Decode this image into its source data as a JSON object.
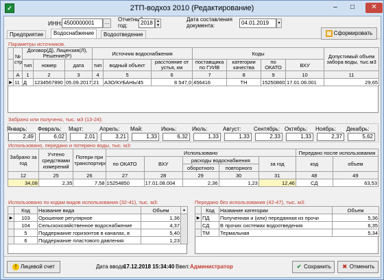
{
  "window": {
    "title": "2ТП-водхоз 2010 (Редактирование)",
    "minimize": "–",
    "maximize": "□",
    "close": "✕"
  },
  "header": {
    "inn_label": "ИНН:",
    "inn_value": "4500000001",
    "inn_btn": "...",
    "year_label": "Отчетный год:",
    "year_value": "2018",
    "date_label": "Дата составления документа:",
    "date_value": "04.01.2019",
    "form_button": "Сформировать"
  },
  "tabs": [
    {
      "label": "Предприятие"
    },
    {
      "label": "Водоснабжение"
    },
    {
      "label": "Водоотведение"
    }
  ],
  "sources": {
    "section": "Параметры источников.",
    "h_num": "№ стр",
    "h_contract": "Договор(Д), Лицензия(Л), Решение(Р)",
    "h_source": "Источник водоснабжения",
    "h_codes": "Коды",
    "h_limit": "Допустимый объем забора воды, тыс.м3",
    "h_type": "тип",
    "h_number": "номер",
    "h_date": "дата",
    "h_stype": "тип",
    "h_object": "водный объект",
    "h_distance": "расстояние от устья, км",
    "h_gouv": "поставщика по ГУИВ",
    "h_quality": "категории качества",
    "h_okato": "по ОКАТО",
    "h_vhu": "ВХУ",
    "n": [
      "А",
      "1",
      "2",
      "3",
      "4",
      "5",
      "6",
      "7",
      "8",
      "9",
      "10",
      "11"
    ],
    "row": {
      "num": "11",
      "type": "Д",
      "number": "1234567890",
      "date": "05.09.2017",
      "stype": "21",
      "object": "АЗО/КУБАНЬ/45",
      "distance": "8 547,0",
      "gouv": "456416",
      "quality": "ТН",
      "okato": "15250860",
      "vhu": "17.01.06.001",
      "limit": "29,65"
    }
  },
  "received": {
    "section": "Забрано или получено, тыс. м3 (13-24):",
    "months": [
      {
        "label": "Январь:",
        "value": "2,49"
      },
      {
        "label": "Февраль:",
        "value": "6,02"
      },
      {
        "label": "Март:",
        "value": "2,01"
      },
      {
        "label": "Апрель:",
        "value": "3,21"
      },
      {
        "label": "Май:",
        "value": "1,33"
      },
      {
        "label": "Июнь:",
        "value": "6,32"
      },
      {
        "label": "Июль:",
        "value": "1,33"
      },
      {
        "label": "Август:",
        "value": "1,33"
      },
      {
        "label": "Сентябрь:",
        "value": "2,33"
      },
      {
        "label": "Октябрь:",
        "value": "1,33"
      },
      {
        "label": "Ноябрь:",
        "value": "2,37"
      },
      {
        "label": "Декабрь:",
        "value": "5,62"
      }
    ]
  },
  "used": {
    "section": "Использовано, передано и потеряно воды, тыс. м3:",
    "h_taken": "Забрано за год",
    "h_meas": "Учтено средствами измерений",
    "h_loss": "Потери при транспортировке",
    "h_used": "Использовано",
    "h_okato": "по ОКАТО",
    "h_vhu": "ВХУ",
    "h_consumption": "расходы водоснабжения",
    "h_circ": "оборотного",
    "h_repeat": "повторного",
    "h_year": "за год",
    "h_passed": "Передано после использования",
    "h_code": "код",
    "h_volume": "объем",
    "n": [
      "12",
      "25",
      "26",
      "27",
      "28",
      "29",
      "30",
      "31",
      "48",
      "49"
    ],
    "row": {
      "taken": "34,08",
      "meas": "2,35",
      "loss": "7,58",
      "okato": "15254850",
      "vhu": "17.01.08.004",
      "circ": "2,36",
      "repeat": "1,23",
      "year": "12,46",
      "code": "СД",
      "volume": "63,53"
    }
  },
  "usage": {
    "section": "Использовано по кодам видов использования (32-41), тыс. м3:",
    "h_code": "Код",
    "h_name": "Название вида",
    "h_volume": "Объем",
    "rows": [
      {
        "code": "103",
        "name": "Орошение регулярное",
        "volume": "1,36"
      },
      {
        "code": "104",
        "name": "Сельскохозяйственное водоснабжение",
        "volume": "4,37"
      },
      {
        "code": "5",
        "name": "Поддержание горизонтов в каналах, в",
        "volume": "5,40"
      },
      {
        "code": "6",
        "name": "Поддержание пластового давления",
        "volume": "1,23"
      }
    ]
  },
  "transfer": {
    "section": "Передано без использования (42-47), тыс. м3:",
    "h_code": "Код",
    "h_name": "Название категории",
    "h_volume": "Объем",
    "rows": [
      {
        "code": "ПД",
        "name": "Полученная и (или) переданная из прочи",
        "volume": "5,36"
      },
      {
        "code": "СД",
        "name": "В прочих системах водоотведения",
        "volume": "6,35"
      },
      {
        "code": "ТМ",
        "name": "Термальная",
        "volume": "5,34"
      }
    ]
  },
  "footer": {
    "account_button": "Лицевой счет",
    "entry_label": "Дата ввода:",
    "entry_value": "17.12.2018 15:34:40",
    "user_label": "Ввел:",
    "user_value": "Администратор",
    "save_button": "Сохранить",
    "cancel_button": "Отменить"
  },
  "colors": {
    "accent": "#1b3f8c",
    "section": "#c0392b",
    "highlight": "#fff7c2",
    "user": "#c0392b"
  }
}
